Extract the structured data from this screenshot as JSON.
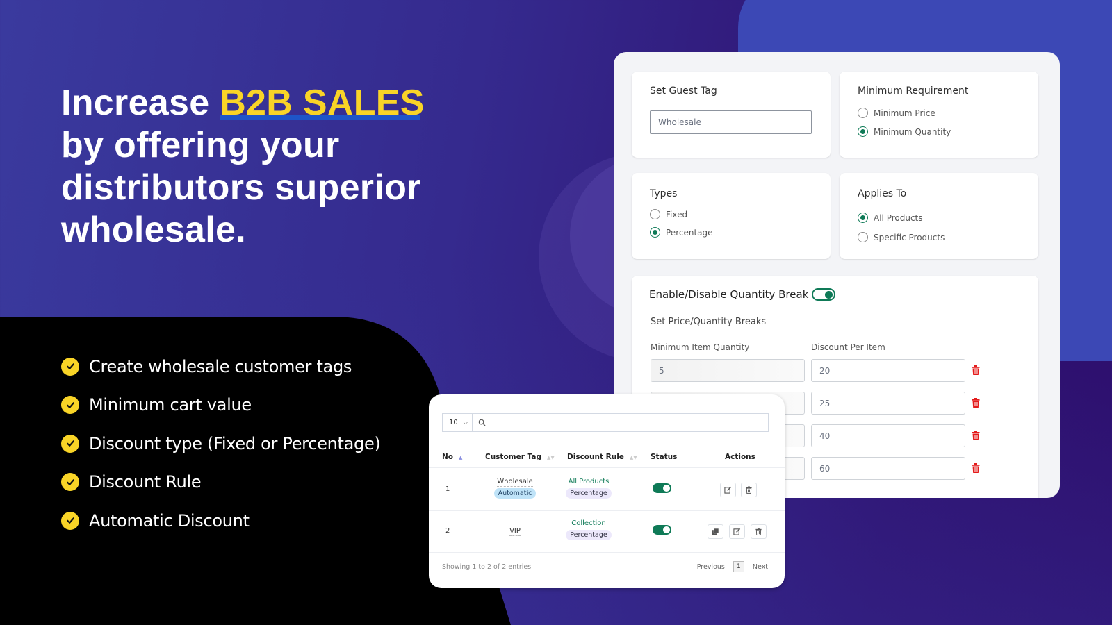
{
  "headline": {
    "prefix": "Increase ",
    "highlight": "B2B SALES",
    "lines": [
      "by offering your",
      "distributors superior",
      "wholesale."
    ]
  },
  "features": [
    "Create wholesale customer tags",
    "Minimum cart value",
    "Discount type (Fixed or Percentage)",
    "Discount Rule",
    "Automatic Discount"
  ],
  "colors": {
    "accent_yellow": "#f9d427",
    "underline_blue": "#1e55c8",
    "toggle_green": "#0f7a57",
    "delete_red": "#e41b1b",
    "bg_purple": "#2e0f6e",
    "bg_blue": "#3c48b5"
  },
  "settings": {
    "guest_tag": {
      "title": "Set Guest Tag",
      "value": "Wholesale"
    },
    "minimum_requirement": {
      "title": "Minimum Requirement",
      "options": [
        {
          "label": "Minimum Price",
          "selected": false
        },
        {
          "label": "Minimum Quantity",
          "selected": true
        }
      ]
    },
    "types": {
      "title": "Types",
      "options": [
        {
          "label": "Fixed",
          "selected": false
        },
        {
          "label": "Percentage",
          "selected": true
        }
      ]
    },
    "applies_to": {
      "title": "Applies To",
      "options": [
        {
          "label": "All Products",
          "selected": true
        },
        {
          "label": "Specific Products",
          "selected": false
        }
      ]
    },
    "quantity_break": {
      "toggle_label": "Enable/Disable Quantity Break",
      "enabled": true,
      "section_title": "Set Price/Quantity Breaks",
      "col_min_qty": "Minimum Item Quantity",
      "col_discount": "Discount Per Item",
      "rows": [
        {
          "min_qty": "5",
          "discount": "20"
        },
        {
          "min_qty": "",
          "discount": "25"
        },
        {
          "min_qty": "",
          "discount": "40"
        },
        {
          "min_qty": "",
          "discount": "60"
        }
      ]
    }
  },
  "table": {
    "page_size": "10",
    "search_value": "",
    "columns": [
      "No",
      "Customer Tag",
      "Discount Rule",
      "Status",
      "Actions"
    ],
    "rows": [
      {
        "no": "1",
        "tag": "Wholesale",
        "tag_badge": "Automatic",
        "rule": "All Products",
        "rule_badge": "Percentage",
        "status": true
      },
      {
        "no": "2",
        "tag": "VIP",
        "tag_badge": "",
        "rule": "Collection",
        "rule_badge": "Percentage",
        "status": true
      }
    ],
    "info": "Showing 1 to 2 of 2 entries",
    "pager": {
      "previous": "Previous",
      "current": "1",
      "next": "Next"
    }
  }
}
